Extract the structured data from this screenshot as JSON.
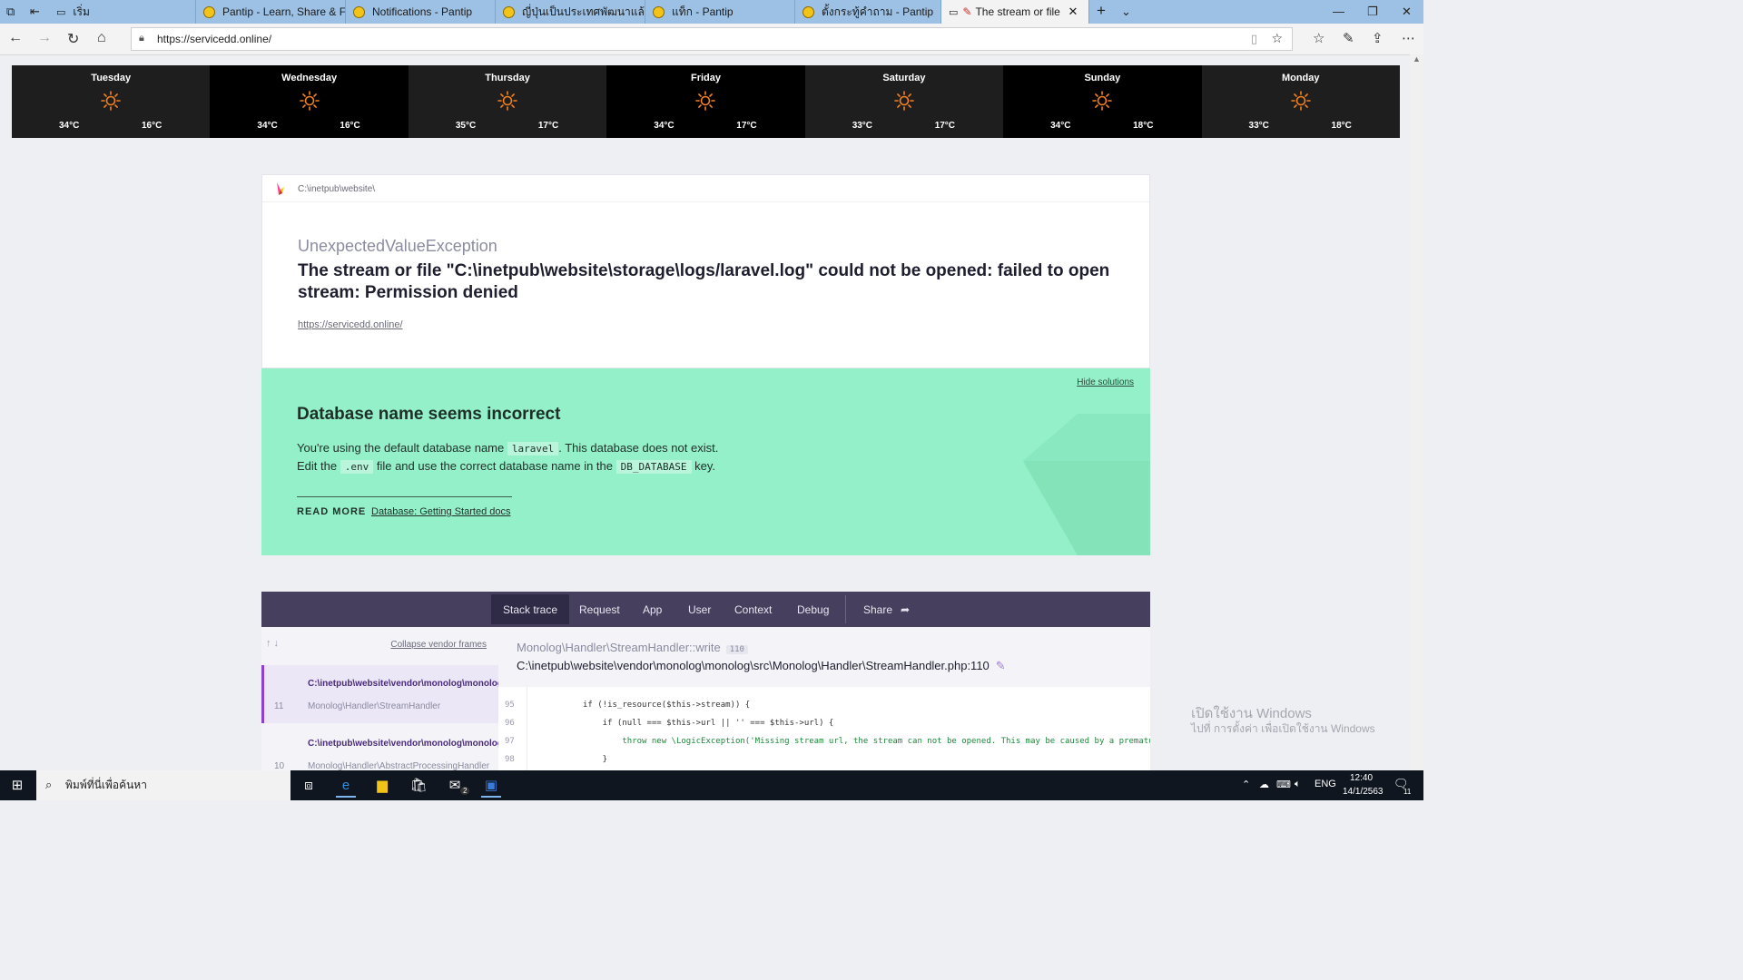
{
  "browser": {
    "tabs": [
      {
        "label": "เริ่ม"
      },
      {
        "label": "Pantip - Learn, Share & Fun"
      },
      {
        "label": "Notifications - Pantip"
      },
      {
        "label": "ญี่ปุ่นเป็นประเทศพัฒนาแล้วมีประ"
      },
      {
        "label": "แท็ก - Pantip"
      },
      {
        "label": "ตั้งกระทู้คำถาม - Pantip"
      },
      {
        "label": "The stream or file \"C"
      }
    ],
    "url": "https://servicedd.online/"
  },
  "weather": {
    "days": [
      {
        "name": "Tuesday",
        "high": "34°C",
        "low": "16°C"
      },
      {
        "name": "Wednesday",
        "high": "34°C",
        "low": "16°C"
      },
      {
        "name": "Thursday",
        "high": "35°C",
        "low": "17°C"
      },
      {
        "name": "Friday",
        "high": "34°C",
        "low": "17°C"
      },
      {
        "name": "Saturday",
        "high": "33°C",
        "low": "17°C"
      },
      {
        "name": "Sunday",
        "high": "34°C",
        "low": "18°C"
      },
      {
        "name": "Monday",
        "high": "33°C",
        "low": "18°C"
      }
    ]
  },
  "error": {
    "path": "C:\\inetpub\\website\\",
    "exception": "UnexpectedValueException",
    "message": "The stream or file \"C:\\inetpub\\website\\storage\\logs/laravel.log\" could not be opened: failed to open stream: Permission denied",
    "url": "https://servicedd.online/"
  },
  "solution": {
    "hide_label": "Hide solutions",
    "title": "Database name seems incorrect",
    "line1_a": "You're using the default database name",
    "line1_code": "laravel",
    "line1_b": ". This database does not exist.",
    "line2_a": "Edit the",
    "line2_code1": ".env",
    "line2_b": "file and use the correct database name in the",
    "line2_code2": "DB_DATABASE",
    "line2_c": "key.",
    "read_more": "READ MORE",
    "doc_link": "Database: Getting Started docs"
  },
  "stack": {
    "tabs": {
      "stack_trace": "Stack trace",
      "request": "Request",
      "app": "App",
      "user": "User",
      "context": "Context",
      "debug": "Debug",
      "share": "Share"
    },
    "collapse_label": "Collapse vendor frames",
    "frames": [
      {
        "path": "C:\\inetpub\\website\\vendor\\monolog\\monolog\\",
        "class": "Monolog\\Handler\\StreamHandler",
        "number": "11"
      },
      {
        "path": "C:\\inetpub\\website\\vendor\\monolog\\monolog\\",
        "class": "Monolog\\Handler\\AbstractProcessingHandler",
        "number": "10"
      }
    ],
    "method": "Monolog\\Handler\\StreamHandler::write",
    "method_line": "110",
    "file": "C:\\inetpub\\website\\vendor\\monolog\\monolog\\src\\Monolog\\Handler\\StreamHandler.php:110",
    "code_lines": [
      {
        "n": "95",
        "text": "if (!is_resource($this->stream)) {"
      },
      {
        "n": "96",
        "text": "    if (null === $this->url || '' === $this->url) {"
      },
      {
        "n": "97",
        "text": "        throw new \\LogicException('Missing stream url, the stream can not be opened. This may be caused by a prematu"
      },
      {
        "n": "98",
        "text": "    }"
      }
    ]
  },
  "watermark": {
    "line1": "เปิดใช้งาน Windows",
    "line2": "ไปที่ การตั้งค่า เพื่อเปิดใช้งาน Windows"
  },
  "taskbar": {
    "search_placeholder": "พิมพ์ที่นี่เพื่อค้นหา",
    "lang": "ENG",
    "time": "12:40",
    "date": "14/1/2563",
    "notif_count": "11",
    "mail_badge": "2"
  },
  "colors": {
    "solution_bg": "#94f0c8",
    "stack_bar": "#463f5e",
    "sun": "#f5821f",
    "tab_strip": "#9dc1e4"
  }
}
